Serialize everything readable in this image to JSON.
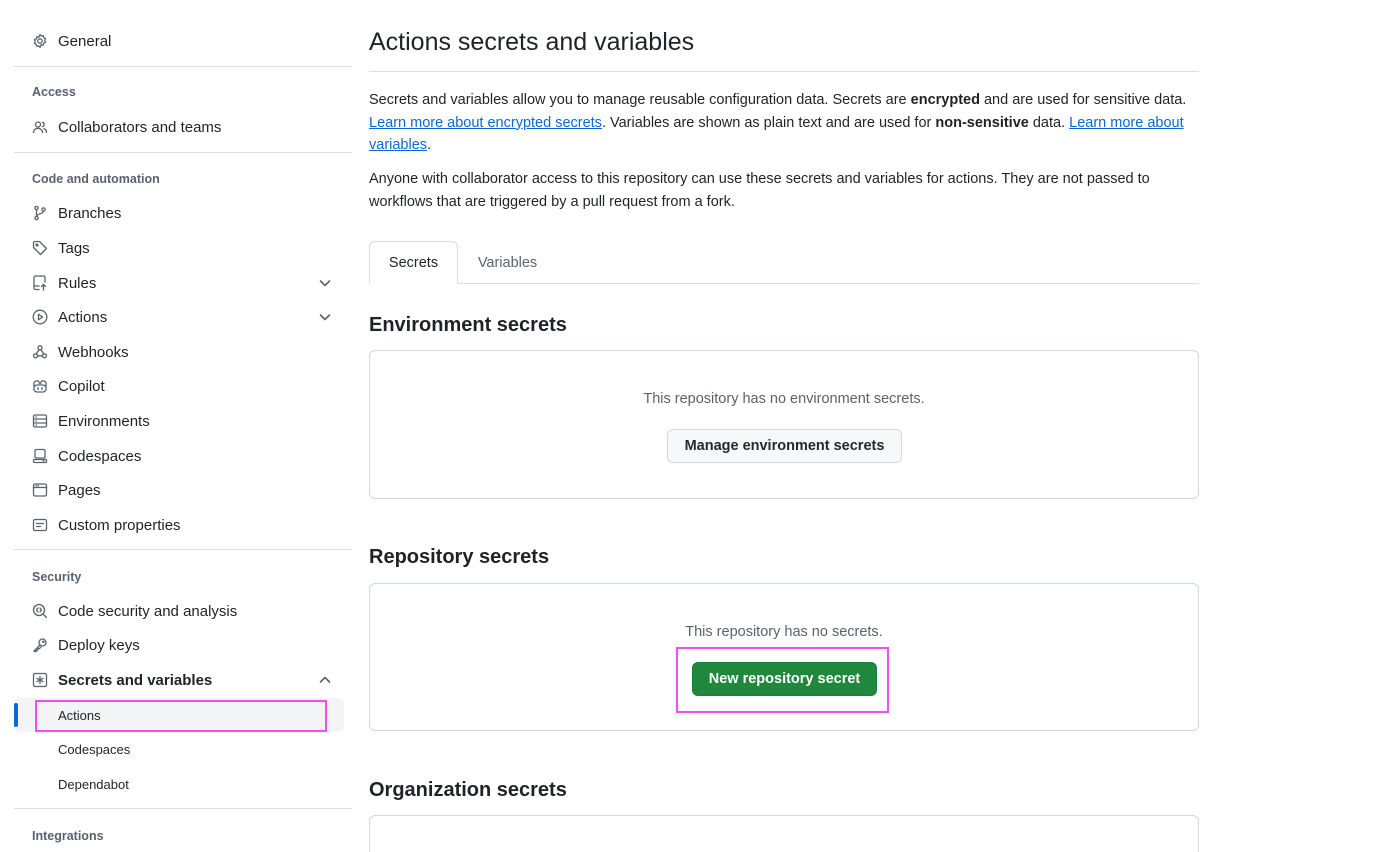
{
  "sidebar": {
    "general": "General",
    "access_heading": "Access",
    "collaborators": "Collaborators and teams",
    "code_heading": "Code and automation",
    "branches": "Branches",
    "tags": "Tags",
    "rules": "Rules",
    "actions": "Actions",
    "webhooks": "Webhooks",
    "copilot": "Copilot",
    "environments": "Environments",
    "codespaces": "Codespaces",
    "pages": "Pages",
    "custom_properties": "Custom properties",
    "security_heading": "Security",
    "code_security": "Code security and analysis",
    "deploy_keys": "Deploy keys",
    "secrets_variables": "Secrets and variables",
    "sub_actions": "Actions",
    "sub_codespaces": "Codespaces",
    "sub_dependabot": "Dependabot",
    "integrations_heading": "Integrations"
  },
  "main": {
    "title": "Actions secrets and variables",
    "intro": {
      "part1": "Secrets and variables allow you to manage reusable configuration data. Secrets are ",
      "bold1": "encrypted",
      "part2": " and are used for sensitive data. ",
      "link1": "Learn more about encrypted secrets",
      "part3": ". Variables are shown as plain text and are used for ",
      "bold2": "non-sensitive",
      "part4": " data. ",
      "link2": "Learn more about variables",
      "part5": "."
    },
    "access_note": "Anyone with collaborator access to this repository can use these secrets and variables for actions. They are not passed to workflows that are triggered by a pull request from a fork.",
    "tabs": [
      "Secrets",
      "Variables"
    ],
    "environment_secrets": {
      "title": "Environment secrets",
      "message": "This repository has no environment secrets.",
      "button": "Manage environment secrets"
    },
    "repository_secrets": {
      "title": "Repository secrets",
      "message": "This repository has no secrets.",
      "button": "New repository secret"
    },
    "organization_secrets": {
      "title": "Organization secrets"
    }
  },
  "colors": {
    "accent": "#0969da",
    "primary_button": "#1f883d",
    "highlight": "#f34cf2"
  }
}
